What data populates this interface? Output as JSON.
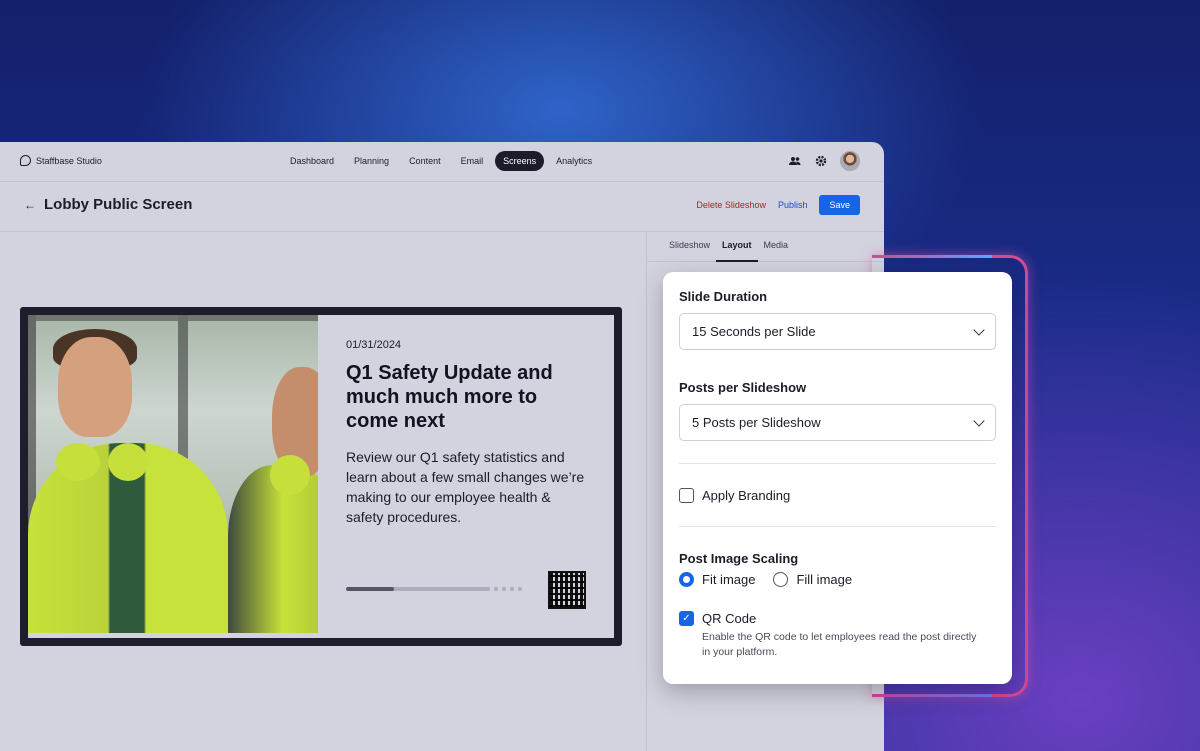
{
  "app": {
    "brand": "Staffbase Studio"
  },
  "nav": [
    {
      "label": "Dashboard",
      "active": false
    },
    {
      "label": "Planning",
      "active": false
    },
    {
      "label": "Content",
      "active": false
    },
    {
      "label": "Email",
      "active": false
    },
    {
      "label": "Screens",
      "active": true
    },
    {
      "label": "Analytics",
      "active": false
    }
  ],
  "header": {
    "title": "Lobby Public Screen",
    "delete_label": "Delete Slideshow",
    "publish_label": "Publish",
    "save_label": "Save"
  },
  "tabs": [
    {
      "label": "Slideshow",
      "active": false
    },
    {
      "label": "Layout",
      "active": true
    },
    {
      "label": "Media",
      "active": false
    }
  ],
  "slide": {
    "date": "01/31/2024",
    "headline": "Q1 Safety Update and much much more to come next",
    "body": "Review our Q1 safety statistics and learn about a few small changes we’re making to our employee health & safety procedures.",
    "progress": 0.33,
    "remaining_dots": 4
  },
  "settings": {
    "slide_duration_label": "Slide Duration",
    "slide_duration_value": "15 Seconds per Slide",
    "posts_label": "Posts per Slideshow",
    "posts_value": "5 Posts per Slideshow",
    "branding_label": "Apply Branding",
    "branding_checked": false,
    "scaling_label": "Post Image Scaling",
    "fit_label": "Fit image",
    "fill_label": "Fill image",
    "scaling_selected": "fit",
    "qr_label": "QR Code",
    "qr_checked": true,
    "qr_hint": "Enable the QR code to let employees read the post directly in your platform."
  },
  "colors": {
    "accent": "#1565e8",
    "danger": "#a12828"
  }
}
